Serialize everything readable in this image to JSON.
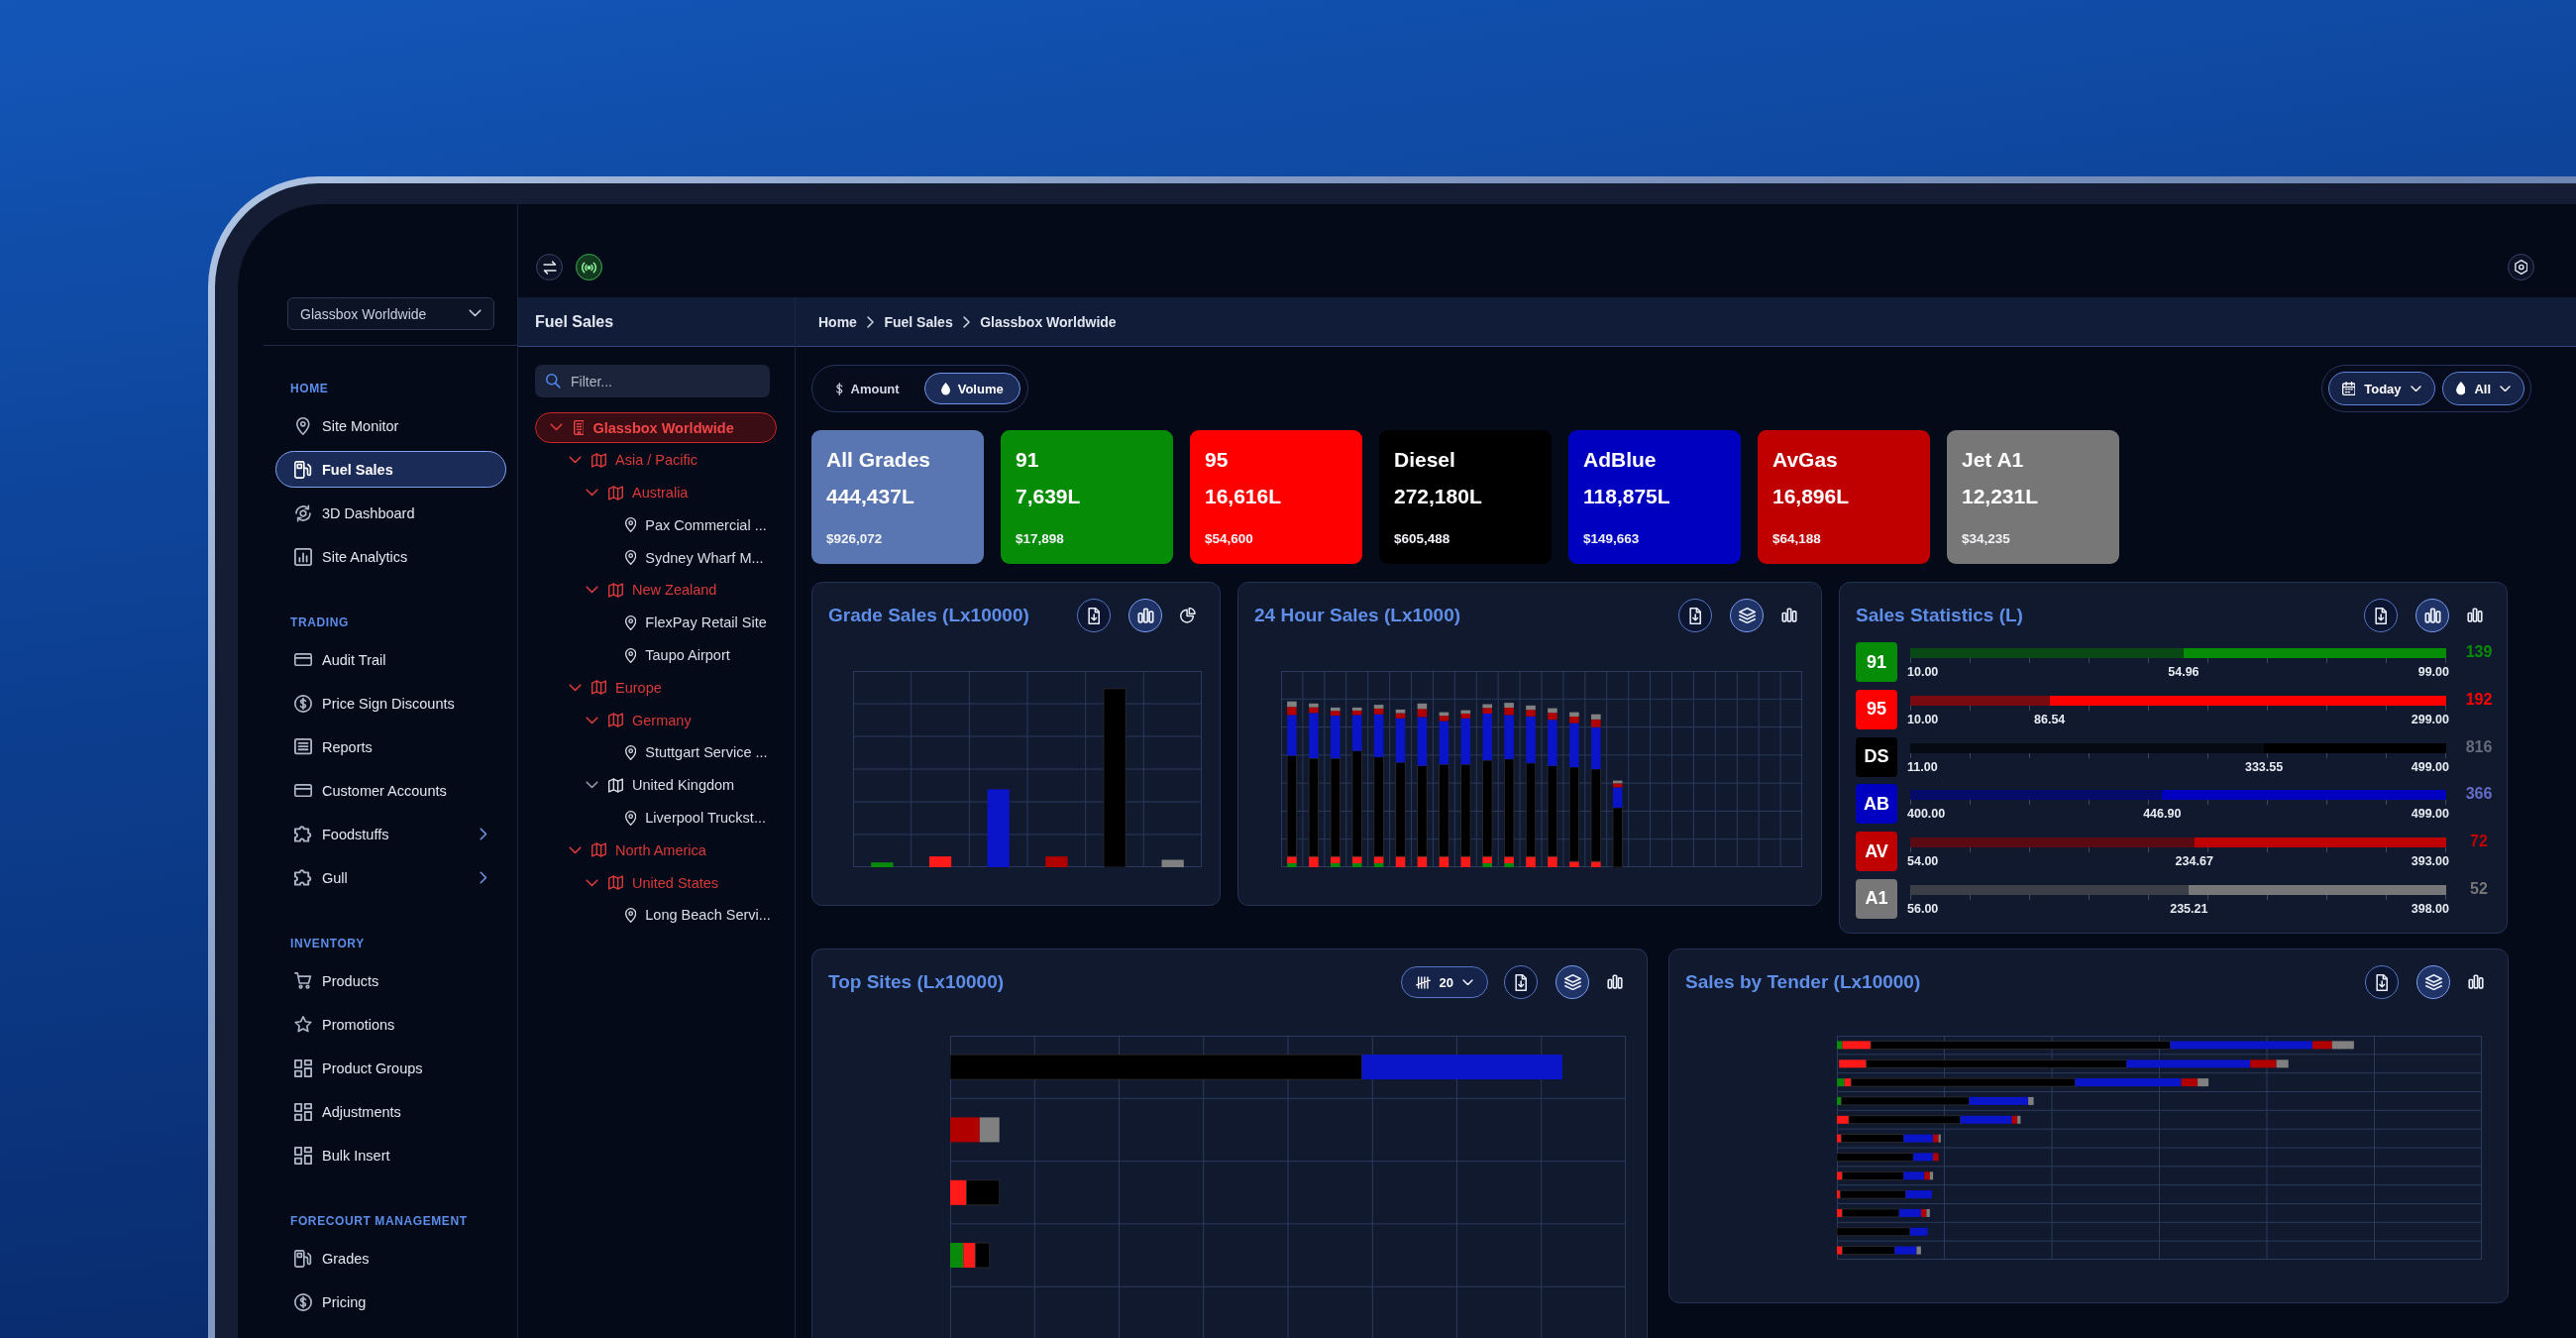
{
  "top_bar": {
    "live": true
  },
  "sidebar": {
    "site_selector": "Glassbox Worldwide",
    "sections": [
      {
        "title": "HOME",
        "items": [
          {
            "label": "Site Monitor",
            "selected": false,
            "submenu": false
          },
          {
            "label": "Fuel Sales",
            "selected": true,
            "submenu": false
          },
          {
            "label": "3D Dashboard",
            "selected": false,
            "submenu": false
          },
          {
            "label": "Site Analytics",
            "selected": false,
            "submenu": false
          }
        ]
      },
      {
        "title": "TRADING",
        "items": [
          {
            "label": "Audit Trail",
            "selected": false,
            "submenu": false
          },
          {
            "label": "Price Sign Discounts",
            "selected": false,
            "submenu": false
          },
          {
            "label": "Reports",
            "selected": false,
            "submenu": false
          },
          {
            "label": "Customer Accounts",
            "selected": false,
            "submenu": false
          },
          {
            "label": "Foodstuffs",
            "selected": false,
            "submenu": true
          },
          {
            "label": "Gull",
            "selected": false,
            "submenu": true
          }
        ]
      },
      {
        "title": "INVENTORY",
        "items": [
          {
            "label": "Products",
            "selected": false,
            "submenu": false
          },
          {
            "label": "Promotions",
            "selected": false,
            "submenu": false
          },
          {
            "label": "Product Groups",
            "selected": false,
            "submenu": false
          },
          {
            "label": "Adjustments",
            "selected": false,
            "submenu": false
          },
          {
            "label": "Bulk Insert",
            "selected": false,
            "submenu": false
          }
        ]
      },
      {
        "title": "FORECOURT MANAGEMENT",
        "items": [
          {
            "label": "Grades",
            "selected": false,
            "submenu": false
          },
          {
            "label": "Pricing",
            "selected": false,
            "submenu": false
          }
        ]
      }
    ]
  },
  "tree_panel": {
    "title": "Fuel Sales",
    "filter": {
      "placeholder": "Filter..."
    },
    "nodes": [
      {
        "label": "Glassbox Worldwide",
        "kind": "company",
        "alert": true,
        "selected": true,
        "expanded": true,
        "children": [
          {
            "label": "Asia / Pacific",
            "kind": "region",
            "alert": true,
            "selected": false,
            "expanded": true,
            "children": [
              {
                "label": "Australia",
                "kind": "region",
                "alert": true,
                "selected": false,
                "expanded": true,
                "children": [
                  {
                    "label": "Pax Commercial ...",
                    "kind": "site",
                    "alert": false,
                    "selected": false
                  },
                  {
                    "label": "Sydney Wharf M...",
                    "kind": "site",
                    "alert": false,
                    "selected": false
                  }
                ]
              },
              {
                "label": "New Zealand",
                "kind": "region",
                "alert": true,
                "selected": false,
                "expanded": true,
                "children": [
                  {
                    "label": "FlexPay Retail Site",
                    "kind": "site",
                    "alert": false,
                    "selected": false
                  },
                  {
                    "label": "Taupo Airport",
                    "kind": "site",
                    "alert": false,
                    "selected": false
                  }
                ]
              }
            ]
          },
          {
            "label": "Europe",
            "kind": "region",
            "alert": true,
            "selected": false,
            "expanded": true,
            "children": [
              {
                "label": "Germany",
                "kind": "region",
                "alert": true,
                "selected": false,
                "expanded": true,
                "children": [
                  {
                    "label": "Stuttgart Service ...",
                    "kind": "site",
                    "alert": false,
                    "selected": false
                  }
                ]
              },
              {
                "label": "United Kingdom",
                "kind": "region",
                "alert": false,
                "selected": false,
                "expanded": true,
                "children": [
                  {
                    "label": "Liverpool Truckst...",
                    "kind": "site",
                    "alert": false,
                    "selected": false
                  }
                ]
              }
            ]
          },
          {
            "label": "North America",
            "kind": "region",
            "alert": true,
            "selected": false,
            "expanded": true,
            "children": [
              {
                "label": "United States",
                "kind": "region",
                "alert": true,
                "selected": false,
                "expanded": true,
                "children": [
                  {
                    "label": "Long Beach Servi...",
                    "kind": "site",
                    "alert": false,
                    "selected": false
                  }
                ]
              }
            ]
          }
        ]
      }
    ]
  },
  "breadcrumbs": [
    "Home",
    "Fuel Sales",
    "Glassbox Worldwide"
  ],
  "measure_toggle": [
    {
      "label": "Amount",
      "selected": false
    },
    {
      "label": "Volume",
      "selected": true
    }
  ],
  "filters": [
    "Today",
    "All"
  ],
  "grade_cards": [
    {
      "title": "All Grades",
      "volume": "444,437L",
      "amount": "$926,072",
      "color": "#5a76b2"
    },
    {
      "title": "91",
      "volume": "7,639L",
      "amount": "$17,898",
      "color": "#078c07"
    },
    {
      "title": "95",
      "volume": "16,616L",
      "amount": "$54,600",
      "color": "#ff0000"
    },
    {
      "title": "Diesel",
      "volume": "272,180L",
      "amount": "$605,488",
      "color": "#000000"
    },
    {
      "title": "AdBlue",
      "volume": "118,875L",
      "amount": "$149,663",
      "color": "#0000c0"
    },
    {
      "title": "AvGas",
      "volume": "16,896L",
      "amount": "$64,188",
      "color": "#c00000"
    },
    {
      "title": "Jet A1",
      "volume": "12,231L",
      "amount": "$34,235",
      "color": "#777777"
    }
  ],
  "grade_sales": {
    "title": "Grade Sales (Lx10000)",
    "views": [
      {
        "kind": "bars",
        "selected": true
      },
      {
        "kind": "pie",
        "selected": false
      }
    ]
  },
  "hourly_sales": {
    "title": "24 Hour Sales (Lx1000)",
    "views": [
      {
        "kind": "stacked",
        "selected": true
      },
      {
        "kind": "bars",
        "selected": false
      }
    ]
  },
  "sales_statistics": {
    "title": "Sales Statistics (L)",
    "views": [
      {
        "kind": "bars",
        "selected": true
      },
      {
        "kind": "bars",
        "selected": false
      }
    ],
    "rows": [
      {
        "badge": "91",
        "color": "#078c07",
        "level": 0.51,
        "min": "10.00",
        "avg": "54.96",
        "max": "99.00",
        "count": "139"
      },
      {
        "badge": "95",
        "color": "#ff0000",
        "level": 0.26,
        "min": "10.00",
        "avg": "86.54",
        "max": "299.00",
        "count": "192"
      },
      {
        "badge": "DS",
        "color": "#000000",
        "level": 0.66,
        "min": "11.00",
        "avg": "333.55",
        "max": "499.00",
        "count": "816"
      },
      {
        "badge": "AB",
        "color": "#0000c0",
        "level": 0.47,
        "min": "400.00",
        "avg": "446.90",
        "max": "499.00",
        "count": "366"
      },
      {
        "badge": "AV",
        "color": "#c00000",
        "level": 0.53,
        "min": "54.00",
        "avg": "234.67",
        "max": "393.00",
        "count": "72"
      },
      {
        "badge": "A1",
        "color": "#777777",
        "level": 0.52,
        "min": "56.00",
        "avg": "235.21",
        "max": "398.00",
        "count": "52"
      }
    ]
  },
  "top_sites": {
    "title": "Top Sites (Lx10000)",
    "limit": "20",
    "views": [
      {
        "kind": "stacked",
        "selected": true
      },
      {
        "kind": "bars",
        "selected": false
      }
    ]
  },
  "sales_by_tender": {
    "title": "Sales by Tender (Lx10000)",
    "views": [
      {
        "kind": "stacked",
        "selected": true
      },
      {
        "kind": "bars",
        "selected": false
      }
    ]
  }
}
